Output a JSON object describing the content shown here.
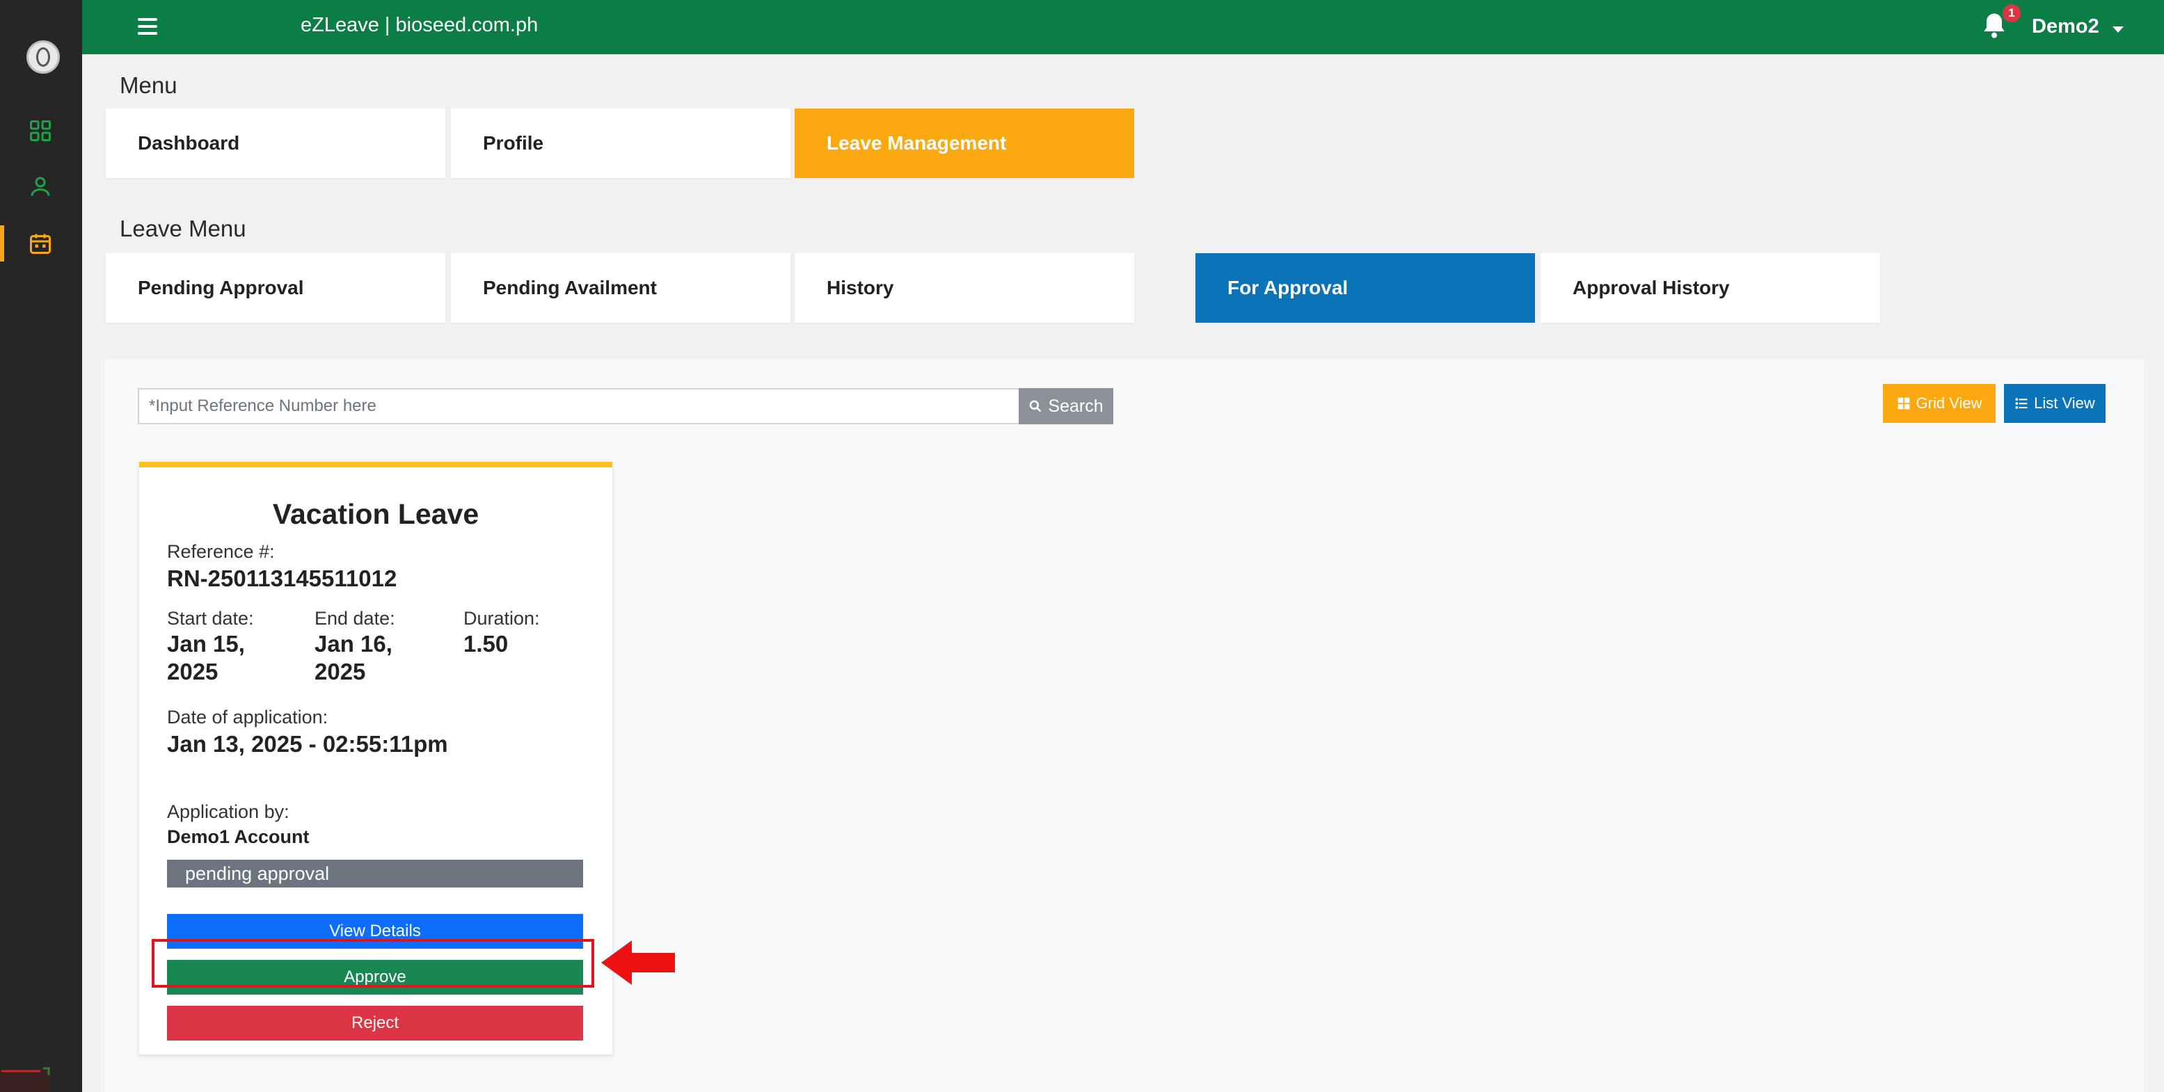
{
  "colors": {
    "topbar": "#0b7d45",
    "rail": "#262626",
    "accent_orange": "#fca811",
    "accent_blue": "#0b73b8",
    "card_top_border": "#fcc11a",
    "view_details": "#0d6efd",
    "approve": "#198754",
    "reject": "#dc3545",
    "status_gray": "#6c757d",
    "annotation_red": "#e0141c"
  },
  "rail": {
    "icons": [
      "logo-icon",
      "dashboard-grid-icon",
      "profile-user-icon",
      "calendar-icon"
    ]
  },
  "header": {
    "title": "eZLeave | bioseed.com.ph",
    "notification_count": "1",
    "user_name": "Demo2"
  },
  "menu": {
    "title": "Menu",
    "items": [
      {
        "label": "Dashboard"
      },
      {
        "label": "Profile"
      },
      {
        "label": "Leave Management"
      }
    ]
  },
  "leave_menu": {
    "title": "Leave Menu",
    "items": [
      {
        "label": "Pending Approval"
      },
      {
        "label": "Pending Availment"
      },
      {
        "label": "History"
      },
      {
        "label": "For Approval"
      },
      {
        "label": "Approval History"
      }
    ]
  },
  "search": {
    "placeholder": "*Input Reference Number here",
    "value": "",
    "button_label": "Search"
  },
  "view_toggle": {
    "grid_label": "Grid View",
    "list_label": "List View"
  },
  "card": {
    "title": "Vacation Leave",
    "reference_label": "Reference #:",
    "reference_value": "RN-250113145511012",
    "start_label": "Start date:",
    "start_line1": "Jan 15,",
    "start_line2": "2025",
    "end_label": "End date:",
    "end_line1": "Jan 16,",
    "end_line2": "2025",
    "duration_label": "Duration:",
    "duration_value": "1.50",
    "application_date_label": "Date of application:",
    "application_date_value": "Jan 13, 2025 - 02:55:11pm",
    "applicant_label": "Application by:",
    "applicant_value": "Demo1 Account",
    "status": "pending approval",
    "view_details_label": "View Details",
    "approve_label": "Approve",
    "reject_label": "Reject"
  }
}
